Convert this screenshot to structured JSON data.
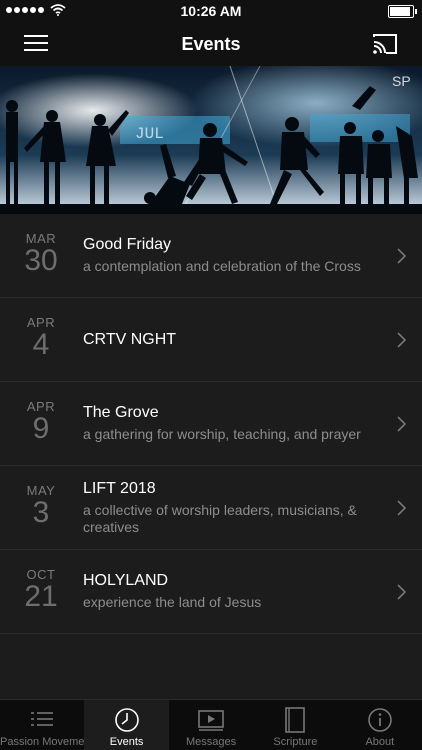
{
  "status_bar": {
    "time": "10:26 AM",
    "battery_level": 0.9
  },
  "nav": {
    "title": "Events"
  },
  "hero": {
    "overlay_text": "JUL",
    "corner_logo": "SP"
  },
  "events": [
    {
      "month": "MAR",
      "day": "30",
      "title": "Good Friday",
      "subtitle": "a contemplation and celebration of the Cross"
    },
    {
      "month": "APR",
      "day": "4",
      "title": "CRTV NGHT",
      "subtitle": ""
    },
    {
      "month": "APR",
      "day": "9",
      "title": "The Grove",
      "subtitle": "a gathering for worship, teaching, and prayer"
    },
    {
      "month": "MAY",
      "day": "3",
      "title": "LIFT 2018",
      "subtitle": "a collective of worship leaders, musicians, & creatives"
    },
    {
      "month": "OCT",
      "day": "21",
      "title": "HOLYLAND",
      "subtitle": "experience the land of Jesus"
    }
  ],
  "tabs": [
    {
      "label": "Passion Movement",
      "icon": "list-icon"
    },
    {
      "label": "Events",
      "icon": "clock-icon",
      "active": true
    },
    {
      "label": "Messages",
      "icon": "video-icon"
    },
    {
      "label": "Scripture",
      "icon": "book-icon"
    },
    {
      "label": "About",
      "icon": "info-icon"
    }
  ]
}
